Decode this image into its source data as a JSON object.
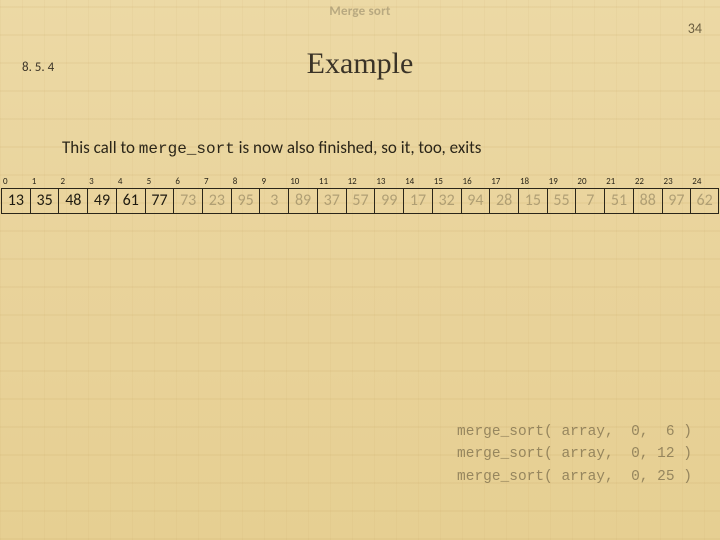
{
  "header": {
    "title": "Merge sort"
  },
  "slide_number": "34",
  "section_number": "8. 5. 4",
  "title": "Example",
  "body": {
    "prefix": "This call to ",
    "code": "merge_sort",
    "suffix": " is now also finished, so it, too, exits"
  },
  "array": {
    "indices": [
      "0",
      "1",
      "2",
      "3",
      "4",
      "5",
      "6",
      "7",
      "8",
      "9",
      "10",
      "11",
      "12",
      "13",
      "14",
      "15",
      "16",
      "17",
      "18",
      "19",
      "20",
      "21",
      "22",
      "23",
      "24"
    ],
    "values": [
      "13",
      "35",
      "48",
      "49",
      "61",
      "77",
      "73",
      "23",
      "95",
      "3",
      "89",
      "37",
      "57",
      "99",
      "17",
      "32",
      "94",
      "28",
      "15",
      "55",
      "7",
      "51",
      "88",
      "97",
      "62"
    ],
    "active_count": 6
  },
  "calls": [
    {
      "fn": "merge_sort( array,  0,  6 )"
    },
    {
      "fn": "merge_sort( array,  0, 12 )"
    },
    {
      "fn": "merge_sort( array,  0, 25 )"
    }
  ]
}
